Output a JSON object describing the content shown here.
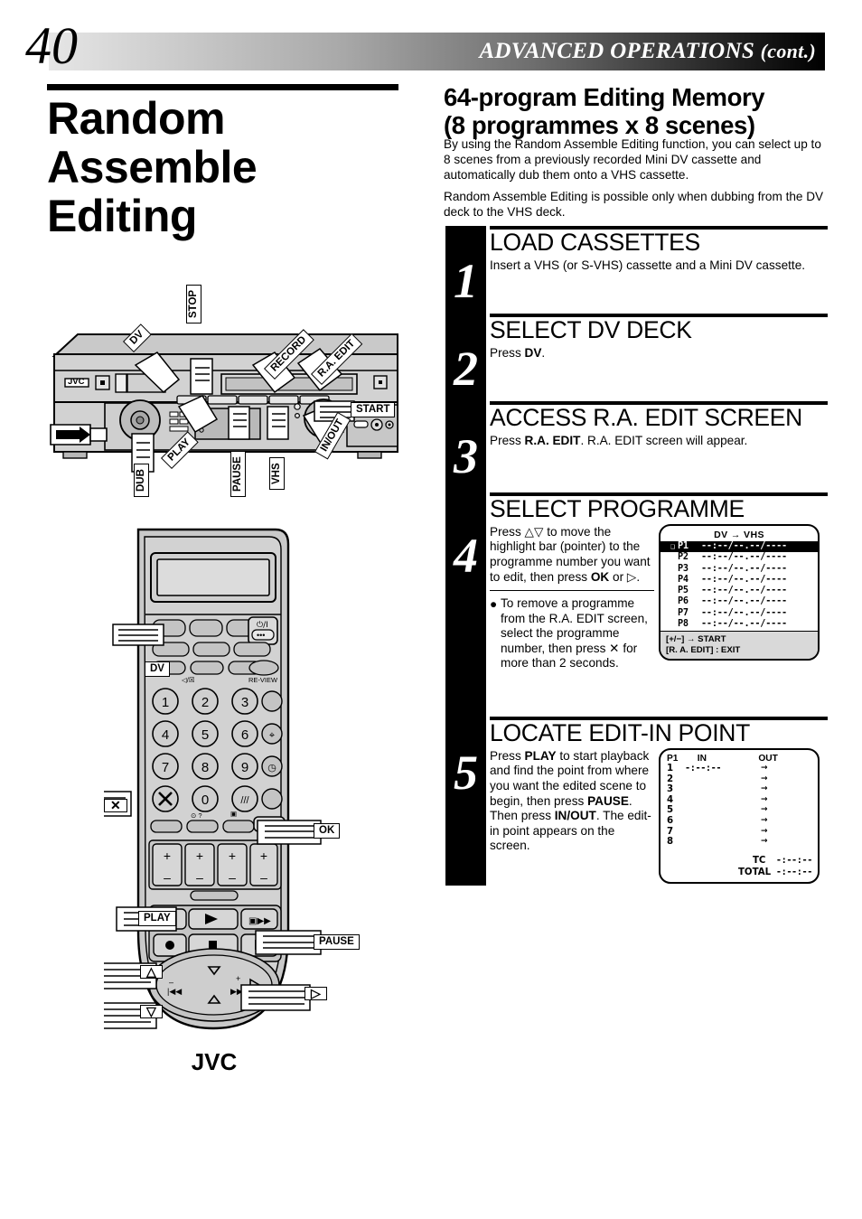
{
  "header": {
    "page_number": "40",
    "section_title": "ADVANCED OPERATIONS",
    "section_cont": "(cont.)"
  },
  "left": {
    "title": "Random Assemble Editing"
  },
  "right": {
    "heading_line1": "64-program Editing Memory",
    "heading_line2": "(8 programmes x 8 scenes)",
    "intro1": "By using the Random Assemble Editing function, you can select up to 8 scenes from a previously recorded Mini DV cassette and automatically dub them onto a VHS cassette.",
    "intro2": "Random Assemble Editing is possible only when dubbing from the DV deck to the VHS deck."
  },
  "steps": [
    {
      "number": "1",
      "title": "LOAD CASSETTES",
      "body": "Insert a VHS (or S-VHS) cassette and a Mini DV cassette."
    },
    {
      "number": "2",
      "title": "SELECT DV DECK",
      "body_pre": "Press ",
      "body_bold": "DV",
      "body_post": "."
    },
    {
      "number": "3",
      "title": "ACCESS R.A. EDIT SCREEN",
      "body_pre": "Press ",
      "body_bold": "R.A. EDIT",
      "body_post": ". R.A. EDIT screen will appear."
    },
    {
      "number": "4",
      "title": "SELECT PROGRAMME",
      "body_a": "Press △▽ to move the highlight bar (pointer) to the programme number you want to edit, then press ",
      "body_bold": "OK",
      "body_b": " or ▷.",
      "bullet_dot": "●",
      "bullet": "To remove a programme from the R.A. EDIT screen, select the programme number, then press ✕ for more than 2 seconds."
    },
    {
      "number": "5",
      "title": "LOCATE EDIT-IN POINT",
      "body_1": "Press ",
      "bold_1": "PLAY",
      "body_2": " to start playback and find the point from where you want the edited scene to begin, then press ",
      "bold_2": "PAUSE",
      "body_3": ". Then press ",
      "bold_3": "IN/OUT",
      "body_4": ". The edit-in point appears on the screen."
    }
  ],
  "osd_programme": {
    "header": "DV → VHS",
    "rows": [
      {
        "mark": "❑",
        "label": "P1",
        "value": "--:--/--.--/----",
        "highlighted": true
      },
      {
        "mark": "",
        "label": "P2",
        "value": "--:--/--.--/----",
        "highlighted": false
      },
      {
        "mark": "",
        "label": "P3",
        "value": "--:--/--.--/----",
        "highlighted": false
      },
      {
        "mark": "",
        "label": "P4",
        "value": "--:--/--.--/----",
        "highlighted": false
      },
      {
        "mark": "",
        "label": "P5",
        "value": "--:--/--.--/----",
        "highlighted": false
      },
      {
        "mark": "",
        "label": "P6",
        "value": "--:--/--.--/----",
        "highlighted": false
      },
      {
        "mark": "",
        "label": "P7",
        "value": "--:--/--.--/----",
        "highlighted": false
      },
      {
        "mark": "",
        "label": "P8",
        "value": "--:--/--.--/----",
        "highlighted": false
      }
    ],
    "footer_line1": "[+/−] →  START",
    "footer_line2": "[R. A. EDIT] : EXIT"
  },
  "osd_editpoint": {
    "col_p": "P1",
    "col_in": "IN",
    "col_out": "OUT",
    "rows": [
      {
        "n": "1",
        "in": "-:--:--",
        "arrow": "→"
      },
      {
        "n": "2",
        "in": "",
        "arrow": "→"
      },
      {
        "n": "3",
        "in": "",
        "arrow": "→"
      },
      {
        "n": "4",
        "in": "",
        "arrow": "→"
      },
      {
        "n": "5",
        "in": "",
        "arrow": "→"
      },
      {
        "n": "6",
        "in": "",
        "arrow": "→"
      },
      {
        "n": "7",
        "in": "",
        "arrow": "→"
      },
      {
        "n": "8",
        "in": "",
        "arrow": "→"
      }
    ],
    "tc_label": "TC",
    "tc_value": "-:--:--",
    "total_label": "TOTAL",
    "total_value": "-:--:--"
  },
  "vcr_callouts": {
    "stop": "STOP",
    "dv": "DV",
    "record": "RECORD",
    "ra_edit": "R.A. EDIT",
    "start": "START",
    "dub": "DUB",
    "play": "PLAY",
    "pause": "PAUSE",
    "vhs": "VHS",
    "in_out": "IN/OUT",
    "brand": "JVC"
  },
  "remote_callouts": {
    "dv": "DV",
    "cancel": "✕",
    "ok": "OK",
    "play": "PLAY",
    "pause": "PAUSE",
    "up": "△",
    "down": "▽",
    "right": "▷",
    "brand": "JVC",
    "power": "⏻/I",
    "review": "RE-VIEW",
    "keys": [
      "1",
      "2",
      "3",
      "4",
      "5",
      "6",
      "7",
      "8",
      "9",
      "0"
    ]
  }
}
